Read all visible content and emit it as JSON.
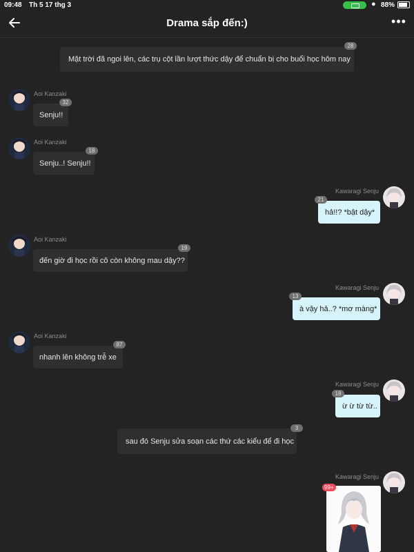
{
  "status_bar": {
    "time": "09:48",
    "date": "Th 5 17 thg 3",
    "battery": "88%"
  },
  "header": {
    "title": "Drama sắp đến:)"
  },
  "narration": [
    {
      "text": "Mặt trời đã ngoi lên, các trụ cột lần lượt thức dậy để chuẩn bị cho buổi học hôm nay",
      "count": "28"
    },
    {
      "text": "sau đó Senju sửa soạn các thứ các kiểu để đi học",
      "count": "3"
    }
  ],
  "messages": [
    {
      "author": "Aoi Kanzaki",
      "text": "Senju!!",
      "count": "32"
    },
    {
      "author": "Aoi Kanzaki",
      "text": "Senju..! Senju!!",
      "count": "18"
    },
    {
      "author": "Kawaragi Senju",
      "text": "hả!!? *bật dậy*",
      "count": "21"
    },
    {
      "author": "Aoi Kanzaki",
      "text": "đến giờ đi học rồi cô còn không mau dậy??",
      "count": "19"
    },
    {
      "author": "Kawaragi Senju",
      "text": "à vậy hả..? *mơ màng*",
      "count": "13"
    },
    {
      "author": "Aoi Kanzaki",
      "text": "nhanh lên không trễ xe",
      "count": "87"
    },
    {
      "author": "Kawaragi Senju",
      "text": "ừ ừ từ từ..",
      "count": "18"
    },
    {
      "author": "Kawaragi Senju",
      "count": "99+"
    }
  ]
}
